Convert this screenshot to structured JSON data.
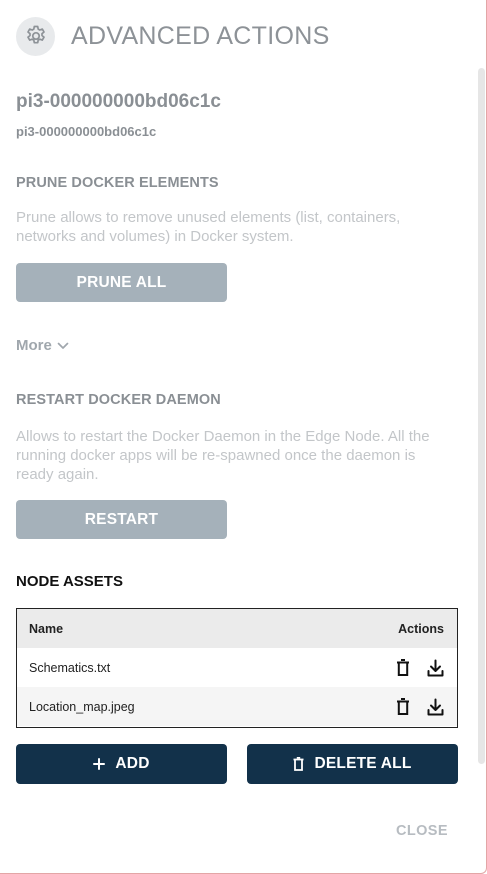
{
  "dialog": {
    "title": "ADVANCED ACTIONS",
    "icon": "gear-icon"
  },
  "node": {
    "name": "pi3-000000000bd06c1c",
    "id": "pi3-000000000bd06c1c"
  },
  "prune": {
    "title": "PRUNE DOCKER ELEMENTS",
    "description": "Prune allows to remove unused elements (list, containers, networks and volumes) in Docker system.",
    "button_label": "PRUNE ALL"
  },
  "more": {
    "label": "More",
    "icon": "chevron-down-icon"
  },
  "restart": {
    "title": "RESTART DOCKER DAEMON",
    "description": "Allows to restart the Docker Daemon in the Edge Node. All the running docker apps will be re-spawned once the daemon is ready again.",
    "button_label": "RESTART"
  },
  "assets": {
    "title": "NODE ASSETS",
    "columns": [
      "Name",
      "Actions"
    ],
    "rows": [
      {
        "name": "Schematics.txt"
      },
      {
        "name": "Location_map.jpeg"
      }
    ],
    "add_label": "ADD",
    "delete_all_label": "DELETE ALL"
  },
  "footer": {
    "close_label": "CLOSE"
  },
  "colors": {
    "primary_dark": "#12314a",
    "disabled_button": "#a5b1ba",
    "muted_text": "#8a8f94"
  }
}
